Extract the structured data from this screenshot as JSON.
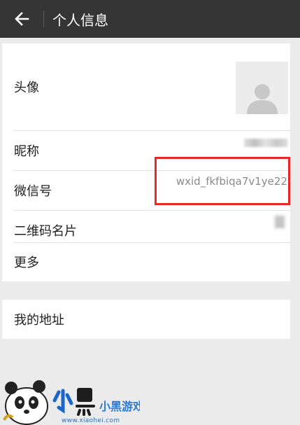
{
  "header": {
    "title": "个人信息",
    "back_icon": "arrow-left-icon"
  },
  "profile": {
    "rows": [
      {
        "label": "头像"
      },
      {
        "label": "昵称"
      },
      {
        "label": "微信号",
        "value": "wxid_fkfbiqa7v1ye22"
      },
      {
        "label": "二维码名片"
      },
      {
        "label": "更多"
      }
    ],
    "highlight_color": "#e62828"
  },
  "address": {
    "label": "我的地址"
  },
  "watermark": {
    "logo_text": "小黑游戏",
    "url": "www.xiaohei.com"
  },
  "colors": {
    "topbar": "#353535",
    "background": "#ebebeb",
    "row": "#ffffff"
  }
}
